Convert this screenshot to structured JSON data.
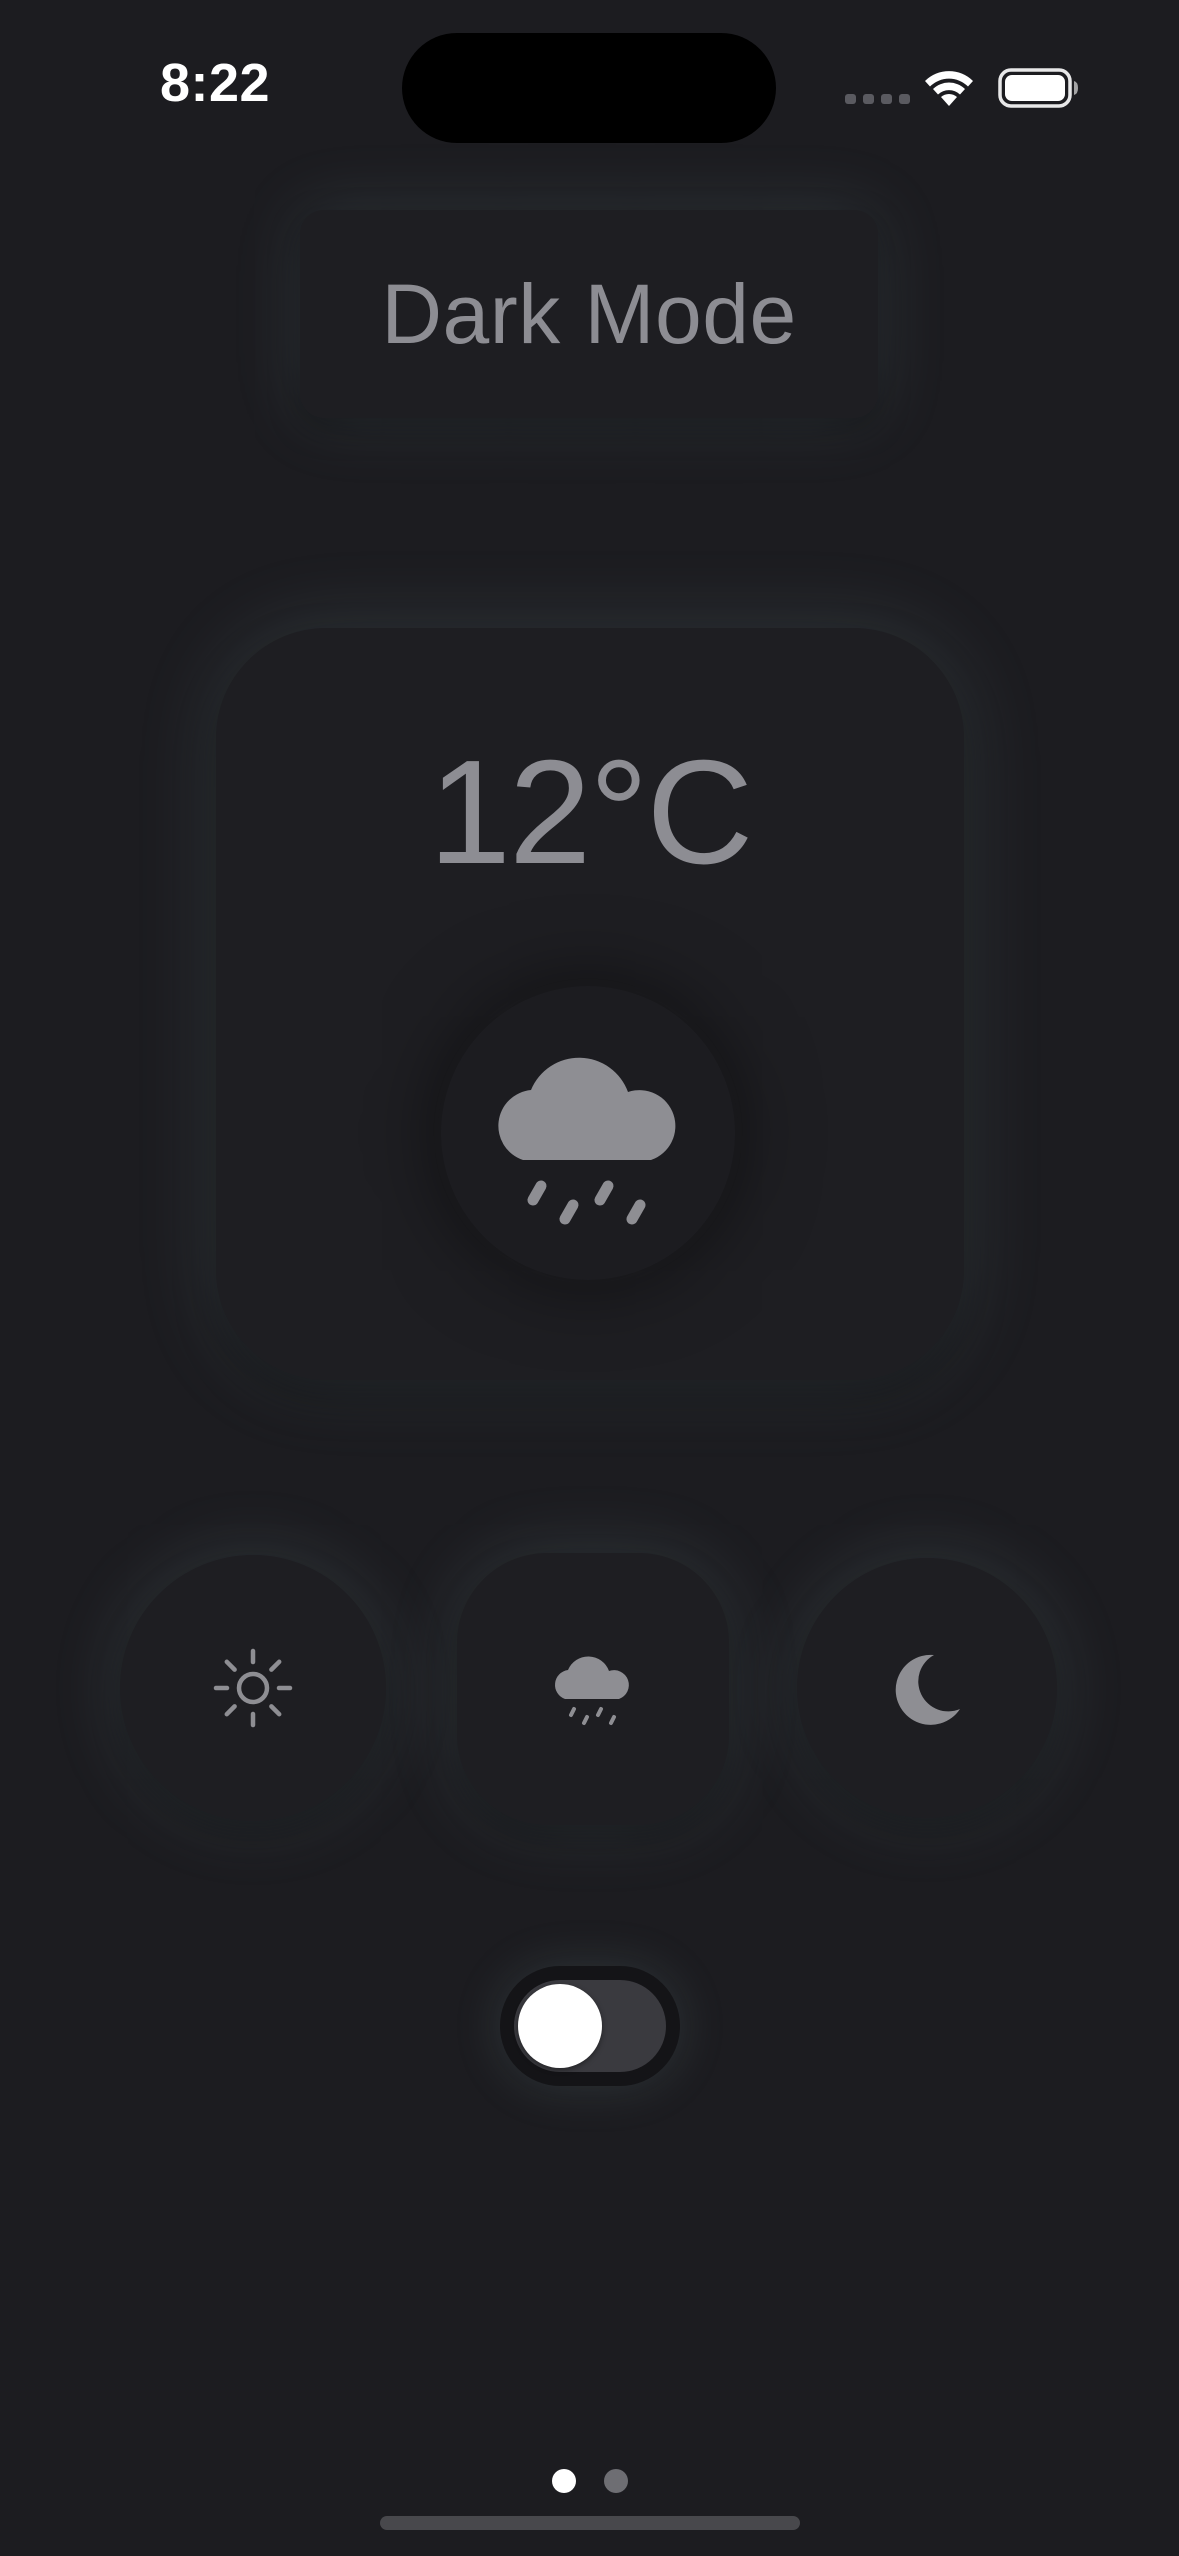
{
  "status_bar": {
    "time": "8:22",
    "signal_icon": "cellular-signal-icon",
    "wifi_icon": "wifi-icon",
    "battery_icon": "battery-full-icon"
  },
  "header": {
    "title": "Dark Mode"
  },
  "weather_card": {
    "temperature": "12°C",
    "condition_icon": "cloud-rain-icon"
  },
  "mode_buttons": [
    {
      "id": "sun",
      "icon": "sun-icon"
    },
    {
      "id": "rain",
      "icon": "cloud-rain-icon"
    },
    {
      "id": "moon",
      "icon": "moon-icon"
    }
  ],
  "toggle": {
    "state": "off"
  },
  "pagination": {
    "pages": 2,
    "current": 1
  },
  "colors": {
    "background": "#1c1c20",
    "card": "#1e1e22",
    "text_secondary": "#8d8d93",
    "glow": "#96b9be"
  }
}
